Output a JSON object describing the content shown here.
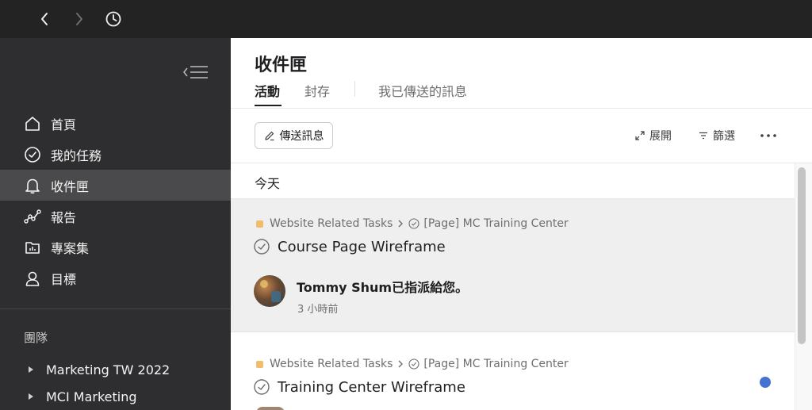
{
  "sidebar": {
    "items": [
      {
        "label": "首頁",
        "icon": "home-icon"
      },
      {
        "label": "我的任務",
        "icon": "check-circle-icon"
      },
      {
        "label": "收件匣",
        "icon": "bell-icon",
        "active": true
      },
      {
        "label": "報告",
        "icon": "chart-line-icon"
      },
      {
        "label": "專案集",
        "icon": "folder-icon"
      },
      {
        "label": "目標",
        "icon": "person-icon"
      }
    ],
    "teams_heading": "團隊",
    "teams": [
      "Marketing TW 2022",
      "MCI Marketing"
    ]
  },
  "main": {
    "title": "收件匣",
    "tabs": [
      "活動",
      "封存",
      "我已傳送的訊息"
    ],
    "active_tab": "活動",
    "toolbar": {
      "send_label": "傳送訊息",
      "expand_label": "展開",
      "filter_label": "篩選"
    },
    "section_today": "今天",
    "notifications": [
      {
        "project": "Website Related Tasks",
        "parent": "[Page] MC Training Center",
        "title": "Course Page Wireframe",
        "activity": "Tommy Shum已指派給您。",
        "time": "3 小時前"
      },
      {
        "project": "Website Related Tasks",
        "parent": "[Page] MC Training Center",
        "title": "Training Center Wireframe",
        "unread": true
      }
    ]
  },
  "colors": {
    "topbar": "#232324",
    "sidebar": "#2e2e30",
    "sidebar_active": "#4a4a4c",
    "project_dot": "#f1bd6c",
    "unread_dot": "#4573d2"
  }
}
